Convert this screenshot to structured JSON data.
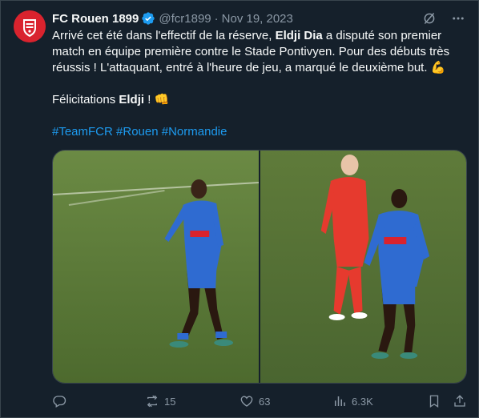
{
  "author": {
    "name": "FC Rouen 1899",
    "handle": "@fcr1899",
    "separator": "·",
    "date": "Nov 19, 2023"
  },
  "icons": {
    "avatar": "fc-rouen-crest-icon",
    "verified": "verified-badge-icon",
    "grok": "grok-icon",
    "more": "more-options-icon",
    "reply": "reply-icon",
    "retweet": "retweet-icon",
    "like": "like-icon",
    "views": "views-icon",
    "bookmark": "bookmark-icon",
    "share": "share-icon"
  },
  "tweet": {
    "line1_a": "Arrivé cet été dans l'effectif de la réserve, ",
    "line1_bold": "Eldji Dia",
    "line1_b": " a disputé son premier",
    "line2": "match en équipe première contre le Stade Pontivyen. Pour des débuts très",
    "line3": "réussis ! L'attaquant, entré à l'heure de jeu, a marqué le deuxième but.",
    "line3_emoji": "💪",
    "congrats_a": "Félicitations ",
    "congrats_bold": "Eldji",
    "congrats_b": " !",
    "congrats_emoji": "👊",
    "hashtags": [
      "#TeamFCR",
      "#Rouen",
      "#Normandie"
    ]
  },
  "media": {
    "photos": [
      "player-photo-left",
      "player-photo-right"
    ]
  },
  "stats": {
    "reply_count": "",
    "retweets": "15",
    "likes": "63",
    "views": "6.3K"
  },
  "colors": {
    "background": "#15202b",
    "text": "#f7f9f9",
    "muted": "#8b98a5",
    "link": "#1d9bf0",
    "brand_red": "#d9232e",
    "pitch": "#5f7b3a"
  }
}
